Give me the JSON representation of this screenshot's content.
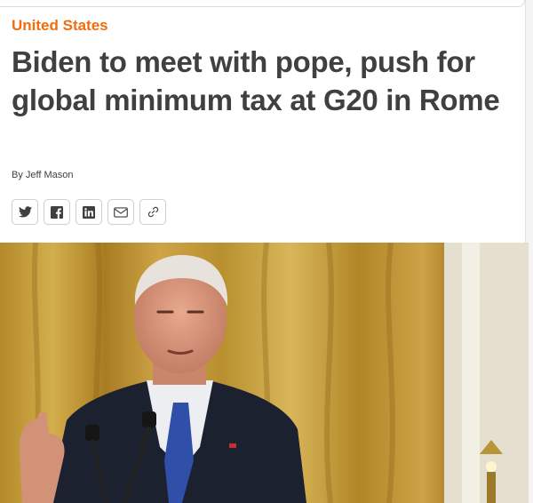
{
  "article": {
    "category": "United States",
    "headline": "Biden to meet with pope, push for global minimum tax at G20 in Rome",
    "byline": "By Jeff Mason"
  },
  "share": {
    "buttons": [
      {
        "name": "twitter",
        "icon": "twitter-icon"
      },
      {
        "name": "facebook",
        "icon": "facebook-icon"
      },
      {
        "name": "linkedin",
        "icon": "linkedin-icon"
      },
      {
        "name": "email",
        "icon": "email-icon"
      },
      {
        "name": "link",
        "icon": "link-icon"
      }
    ]
  },
  "image": {
    "subject": "photo"
  },
  "colors": {
    "category": "#f26c0d",
    "text": "#404040"
  }
}
